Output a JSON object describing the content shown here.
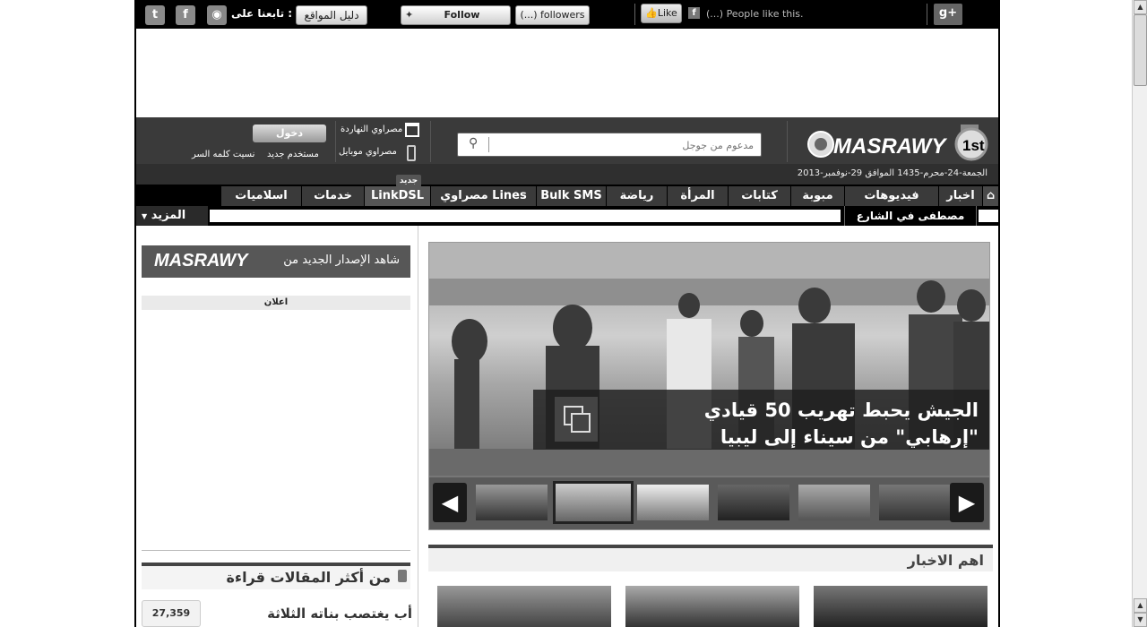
{
  "topbar": {
    "follow_us": "تابعنا على :",
    "sites_guide": "دليل المواقع",
    "follow_twitter": "Follow @Masrawy",
    "followers": "(...) followers",
    "like": "Like",
    "people_like": "(...) People like this.",
    "gplus": "g+"
  },
  "header": {
    "search_placeholder": "مدعوم من جوجل",
    "login": "دخول",
    "new_user": "مستخدم جديد",
    "forgot_password": "نسيت كلمه السر",
    "masrawy_today": "مصراوي النهاردة",
    "masrawy_mobile": "مصراوي موبايل",
    "date": "الجمعة-24-محرم-1435 الموافق 29-نوفمبر-2013",
    "logo_text": "MASRAWY",
    "badge": "1st"
  },
  "nav": {
    "items": [
      "اخبار",
      "فيديوهات",
      "مبوبة",
      "كتابات",
      "المرأة",
      "رياضة",
      "Bulk SMS",
      "مصراوي Lines",
      "LinkDSL",
      "خدمات",
      "اسلاميات"
    ],
    "new_badge": "جديد",
    "more": "المزيد",
    "sub_text": "مصطفى في الشارع"
  },
  "slider": {
    "headline": "الجيش يحبط تهريب 50 قيادي \"إرهابي\" من سيناء إلى ليبيا"
  },
  "sections": {
    "top_news": "اهم الاخبار",
    "most_read": "من أكثر المقالات قراءة",
    "most_read_first": "أب يغتصب بناته الثلاثة",
    "most_read_count": "27,359"
  },
  "sidebar": {
    "banner": "شاهد الإصدار الجديد من",
    "banner_logo": "MASRAWY",
    "ads": "اعلان"
  }
}
